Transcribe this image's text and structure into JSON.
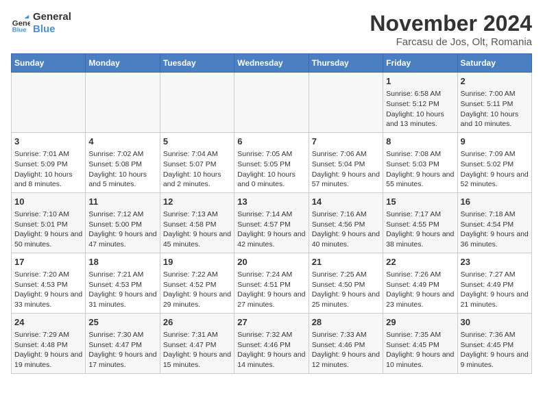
{
  "logo": {
    "line1": "General",
    "line2": "Blue"
  },
  "title": "November 2024",
  "subtitle": "Farcasu de Jos, Olt, Romania",
  "header": {
    "columns": [
      "Sunday",
      "Monday",
      "Tuesday",
      "Wednesday",
      "Thursday",
      "Friday",
      "Saturday"
    ]
  },
  "rows": [
    [
      {
        "day": "",
        "info": ""
      },
      {
        "day": "",
        "info": ""
      },
      {
        "day": "",
        "info": ""
      },
      {
        "day": "",
        "info": ""
      },
      {
        "day": "",
        "info": ""
      },
      {
        "day": "1",
        "info": "Sunrise: 6:58 AM\nSunset: 5:12 PM\nDaylight: 10 hours and 13 minutes."
      },
      {
        "day": "2",
        "info": "Sunrise: 7:00 AM\nSunset: 5:11 PM\nDaylight: 10 hours and 10 minutes."
      }
    ],
    [
      {
        "day": "3",
        "info": "Sunrise: 7:01 AM\nSunset: 5:09 PM\nDaylight: 10 hours and 8 minutes."
      },
      {
        "day": "4",
        "info": "Sunrise: 7:02 AM\nSunset: 5:08 PM\nDaylight: 10 hours and 5 minutes."
      },
      {
        "day": "5",
        "info": "Sunrise: 7:04 AM\nSunset: 5:07 PM\nDaylight: 10 hours and 2 minutes."
      },
      {
        "day": "6",
        "info": "Sunrise: 7:05 AM\nSunset: 5:05 PM\nDaylight: 10 hours and 0 minutes."
      },
      {
        "day": "7",
        "info": "Sunrise: 7:06 AM\nSunset: 5:04 PM\nDaylight: 9 hours and 57 minutes."
      },
      {
        "day": "8",
        "info": "Sunrise: 7:08 AM\nSunset: 5:03 PM\nDaylight: 9 hours and 55 minutes."
      },
      {
        "day": "9",
        "info": "Sunrise: 7:09 AM\nSunset: 5:02 PM\nDaylight: 9 hours and 52 minutes."
      }
    ],
    [
      {
        "day": "10",
        "info": "Sunrise: 7:10 AM\nSunset: 5:01 PM\nDaylight: 9 hours and 50 minutes."
      },
      {
        "day": "11",
        "info": "Sunrise: 7:12 AM\nSunset: 5:00 PM\nDaylight: 9 hours and 47 minutes."
      },
      {
        "day": "12",
        "info": "Sunrise: 7:13 AM\nSunset: 4:58 PM\nDaylight: 9 hours and 45 minutes."
      },
      {
        "day": "13",
        "info": "Sunrise: 7:14 AM\nSunset: 4:57 PM\nDaylight: 9 hours and 42 minutes."
      },
      {
        "day": "14",
        "info": "Sunrise: 7:16 AM\nSunset: 4:56 PM\nDaylight: 9 hours and 40 minutes."
      },
      {
        "day": "15",
        "info": "Sunrise: 7:17 AM\nSunset: 4:55 PM\nDaylight: 9 hours and 38 minutes."
      },
      {
        "day": "16",
        "info": "Sunrise: 7:18 AM\nSunset: 4:54 PM\nDaylight: 9 hours and 36 minutes."
      }
    ],
    [
      {
        "day": "17",
        "info": "Sunrise: 7:20 AM\nSunset: 4:53 PM\nDaylight: 9 hours and 33 minutes."
      },
      {
        "day": "18",
        "info": "Sunrise: 7:21 AM\nSunset: 4:53 PM\nDaylight: 9 hours and 31 minutes."
      },
      {
        "day": "19",
        "info": "Sunrise: 7:22 AM\nSunset: 4:52 PM\nDaylight: 9 hours and 29 minutes."
      },
      {
        "day": "20",
        "info": "Sunrise: 7:24 AM\nSunset: 4:51 PM\nDaylight: 9 hours and 27 minutes."
      },
      {
        "day": "21",
        "info": "Sunrise: 7:25 AM\nSunset: 4:50 PM\nDaylight: 9 hours and 25 minutes."
      },
      {
        "day": "22",
        "info": "Sunrise: 7:26 AM\nSunset: 4:49 PM\nDaylight: 9 hours and 23 minutes."
      },
      {
        "day": "23",
        "info": "Sunrise: 7:27 AM\nSunset: 4:49 PM\nDaylight: 9 hours and 21 minutes."
      }
    ],
    [
      {
        "day": "24",
        "info": "Sunrise: 7:29 AM\nSunset: 4:48 PM\nDaylight: 9 hours and 19 minutes."
      },
      {
        "day": "25",
        "info": "Sunrise: 7:30 AM\nSunset: 4:47 PM\nDaylight: 9 hours and 17 minutes."
      },
      {
        "day": "26",
        "info": "Sunrise: 7:31 AM\nSunset: 4:47 PM\nDaylight: 9 hours and 15 minutes."
      },
      {
        "day": "27",
        "info": "Sunrise: 7:32 AM\nSunset: 4:46 PM\nDaylight: 9 hours and 14 minutes."
      },
      {
        "day": "28",
        "info": "Sunrise: 7:33 AM\nSunset: 4:46 PM\nDaylight: 9 hours and 12 minutes."
      },
      {
        "day": "29",
        "info": "Sunrise: 7:35 AM\nSunset: 4:45 PM\nDaylight: 9 hours and 10 minutes."
      },
      {
        "day": "30",
        "info": "Sunrise: 7:36 AM\nSunset: 4:45 PM\nDaylight: 9 hours and 9 minutes."
      }
    ]
  ],
  "colors": {
    "header_bg": "#4a7fc1",
    "header_text": "#ffffff",
    "row_odd": "#f7f7f7",
    "row_even": "#ffffff"
  }
}
